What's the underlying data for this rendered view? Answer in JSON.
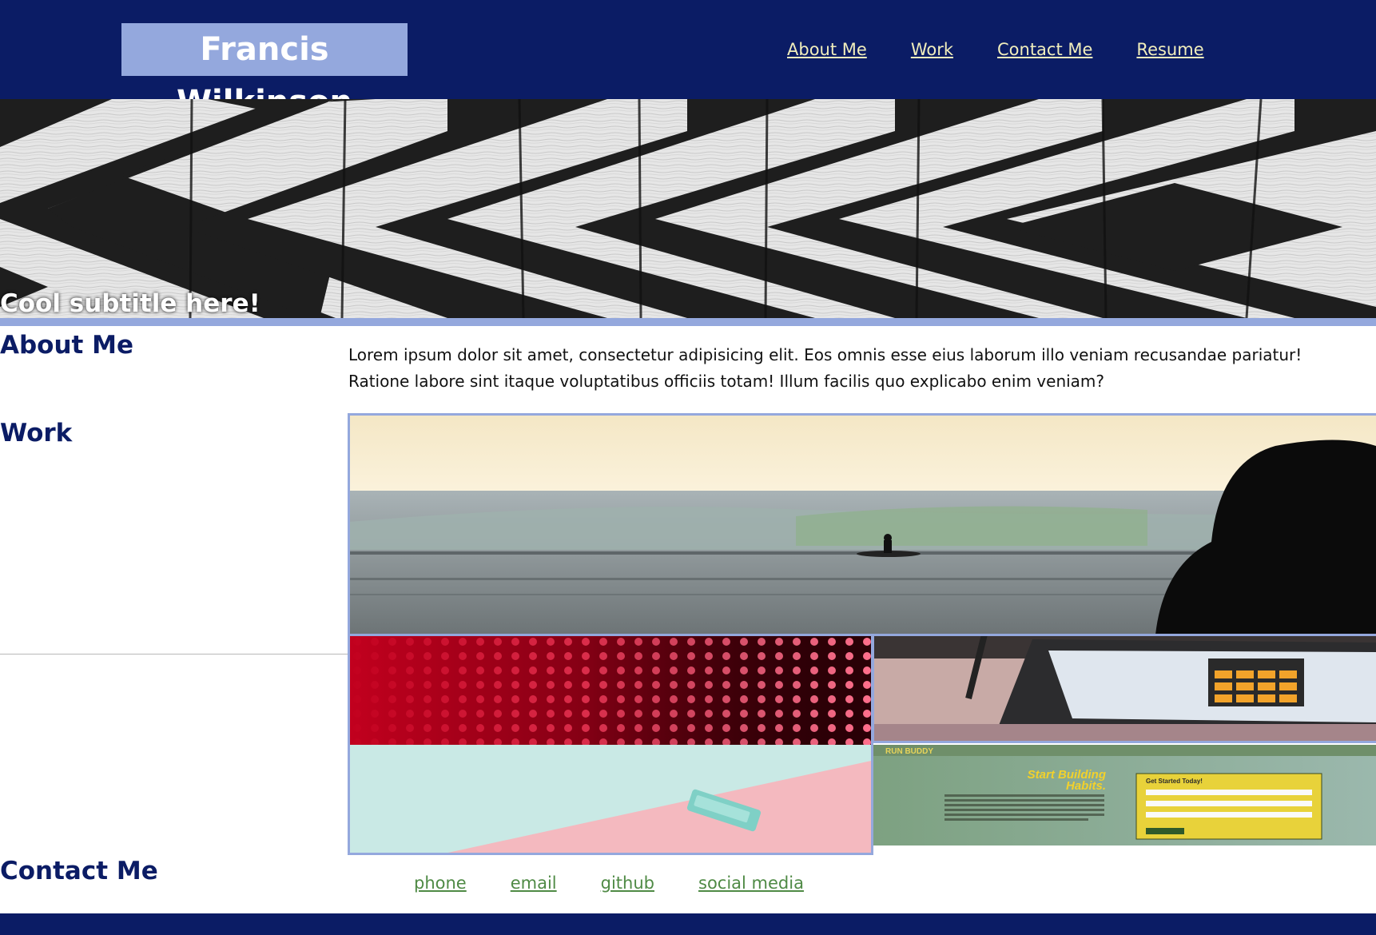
{
  "header": {
    "brand": "Francis Wilkinson",
    "nav": [
      "About Me",
      "Work",
      "Contact Me",
      "Resume"
    ]
  },
  "hero": {
    "subtitle": "Cool subtitle here!"
  },
  "about": {
    "title": "About Me",
    "text": "Lorem ipsum dolor sit amet, consectetur adipisicing elit. Eos omnis esse eius laborum illo veniam recusandae pariatur! Ratione labore sint itaque voluptatibus officiis totam! Illum facilis quo explicabo enim veniam?"
  },
  "work": {
    "title": "Work",
    "projects": [
      {
        "image": "surfer-at-sunset"
      },
      {
        "image": "red-led-wall"
      },
      {
        "image": "laptop-calculator"
      },
      {
        "image": "phone-on-pastel"
      },
      {
        "image": "run-buddy-screenshot"
      }
    ],
    "run_buddy": {
      "brand": "RUN BUDDY",
      "headline_1": "Start Building",
      "headline_2": "Habits.",
      "form_title": "Get Started Today!"
    }
  },
  "contact": {
    "title": "Contact Me",
    "links": [
      "phone",
      "email",
      "github",
      "social media"
    ]
  },
  "colors": {
    "navy": "#0b1c65",
    "periwinkle": "#94a8dd",
    "nav_link": "#f1eebc",
    "contact_link": "#4f8a45"
  }
}
